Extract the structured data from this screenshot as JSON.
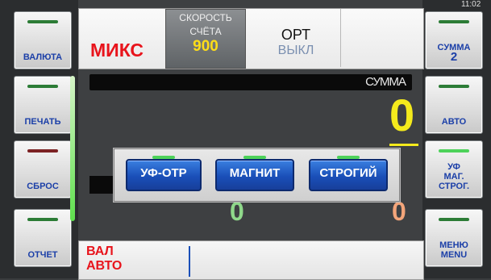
{
  "clock": "11:02",
  "left_buttons": [
    {
      "label": "ВАЛЮТА",
      "bar": "green"
    },
    {
      "label": "ПЕЧАТЬ",
      "bar": "green"
    },
    {
      "label": "СБРОС",
      "bar": "red"
    },
    {
      "label": "ОТЧЕТ",
      "bar": "green"
    }
  ],
  "right_buttons": [
    {
      "label": "СУММА",
      "value": "2",
      "bar": "green"
    },
    {
      "label": "АВТО",
      "bar": "green"
    },
    {
      "label": "УФ\nМАГ.\nСТРОГ.",
      "bar": "bright"
    },
    {
      "label": "МЕНЮ\nMENU",
      "bar": "green"
    }
  ],
  "top": {
    "mode": "МИКС",
    "speed_label_1": "СКОРОСТЬ",
    "speed_label_2": "СЧЁТА",
    "speed_value": "900",
    "ort_label": "ОРТ",
    "ort_value": "ВЫКЛ"
  },
  "sum": {
    "label": "СУММА",
    "value": "0"
  },
  "counters": {
    "green_value": "0",
    "orange_value": "0"
  },
  "dialog": {
    "buttons": [
      "УФ-ОТР",
      "МАГНИТ",
      "СТРОГИЙ"
    ]
  },
  "bottom": {
    "line1": "ВАЛ",
    "line2": "АВТО"
  },
  "colors": {
    "accent_blue": "#1b3fa8",
    "mode_red": "#e8141c",
    "speed_yellow": "#ffdd18",
    "sum_yellow": "#f4ea1c"
  }
}
